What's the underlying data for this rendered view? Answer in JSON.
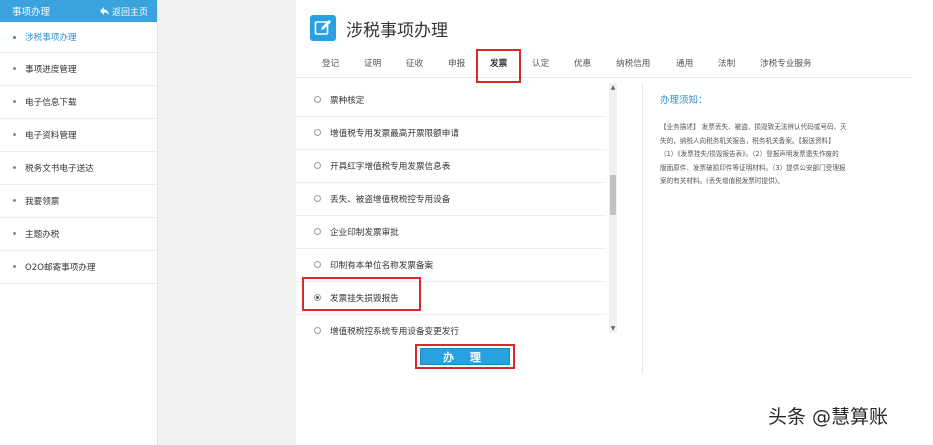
{
  "sidebar": {
    "title": "事项办理",
    "back_label": "返回主页",
    "items": [
      {
        "label": "涉税事项办理",
        "active": true
      },
      {
        "label": "事项进度管理"
      },
      {
        "label": "电子信息下载"
      },
      {
        "label": "电子资料管理"
      },
      {
        "label": "税务文书电子送达"
      },
      {
        "label": "我要领票"
      },
      {
        "label": "主题办税"
      },
      {
        "label": "O2O邮寄事项办理"
      }
    ]
  },
  "main": {
    "title": "涉税事项办理",
    "title_icon": "edit-icon",
    "tabs": [
      {
        "label": "登记"
      },
      {
        "label": "证明"
      },
      {
        "label": "征收"
      },
      {
        "label": "申报"
      },
      {
        "label": "发票",
        "active": true
      },
      {
        "label": "认定"
      },
      {
        "label": "优惠"
      },
      {
        "label": "纳税信用"
      },
      {
        "label": "通用"
      },
      {
        "label": "法制"
      },
      {
        "label": "涉税专业服务"
      }
    ],
    "items": [
      {
        "label": "票种核定"
      },
      {
        "label": "增值税专用发票最高开票限额申请"
      },
      {
        "label": "开具红字增值税专用发票信息表"
      },
      {
        "label": "丢失、被盗增值税税控专用设备"
      },
      {
        "label": "企业印制发票审批"
      },
      {
        "label": "印制有本单位名称发票备案"
      },
      {
        "label": "发票挂失损毁报告",
        "checked": true
      },
      {
        "label": "增值税税控系统专用设备变更发行"
      }
    ],
    "submit_label": "办 理"
  },
  "notice": {
    "title": "办理须知：",
    "lines": [
      "【业务描述】 发票丢失、被盗、损毁致无法辨认代码或号码、灭",
      "失的，纳税人向税务机关报告，税务机关备案。【报送资料】",
      "（1）《发票挂失/损毁报告表》。（2）登报声明发票遗失作废的",
      "版面原件、发票破损印件等证明材料。（3）提供公安部门受理报",
      "案的有关材料。(丢失增值税发票时提供)。"
    ]
  },
  "watermark": "头条 @慧算账",
  "colors": {
    "accent": "#29a1e0",
    "highlight": "#e0262d"
  }
}
